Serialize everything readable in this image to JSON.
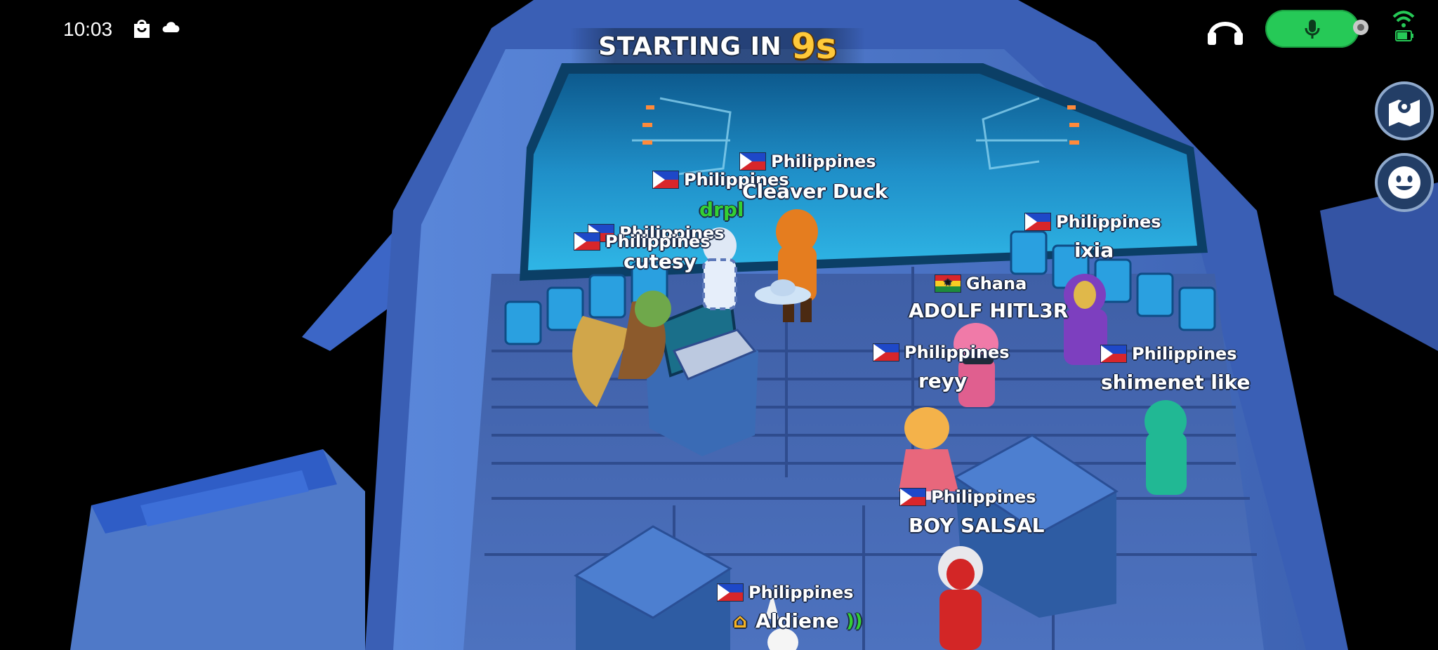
{
  "status_bar": {
    "time": "10:03",
    "icons": [
      "bag-notification-icon",
      "cloud-icon"
    ]
  },
  "countdown": {
    "label": "STARTING IN",
    "value": "9s"
  },
  "top_controls": {
    "headset_icon": "headset-icon",
    "mic_icon": "microphone-icon",
    "wifi_icon": "wifi-icon",
    "battery_icon": "battery-icon",
    "mic_color": "#26c957"
  },
  "side_buttons": [
    {
      "icon": "map-icon"
    },
    {
      "icon": "emoji-face-icon"
    }
  ],
  "players": [
    {
      "country": "Philippines",
      "flag": "ph",
      "name": ""
    },
    {
      "country": "Philippines",
      "flag": "ph",
      "name": "Cleaver Duck"
    },
    {
      "country": "Philippines",
      "flag": "ph",
      "name": "drpl"
    },
    {
      "country": "Philippines",
      "flag": "ph",
      "name": ""
    },
    {
      "country": "Philippines",
      "flag": "ph",
      "name": "cutesy"
    },
    {
      "country": "Philippines",
      "flag": "ph",
      "name": "ixia"
    },
    {
      "country": "Ghana",
      "flag": "gh",
      "name": "ADOLF HITL3R"
    },
    {
      "country": "Philippines",
      "flag": "ph",
      "name": "reyy"
    },
    {
      "country": "Philippines",
      "flag": "ph",
      "name": "shimenet like"
    },
    {
      "country": "Philippines",
      "flag": "ph",
      "name": "BOY SALSAL"
    },
    {
      "country": "Philippines",
      "flag": "ph",
      "name": "Aldiene"
    }
  ],
  "colors": {
    "countdown_number": "#ffc93a",
    "self_name_green": "#33d033",
    "cockpit_blue": "#4a73c4",
    "screen_cyan": "#2fb6e6"
  }
}
